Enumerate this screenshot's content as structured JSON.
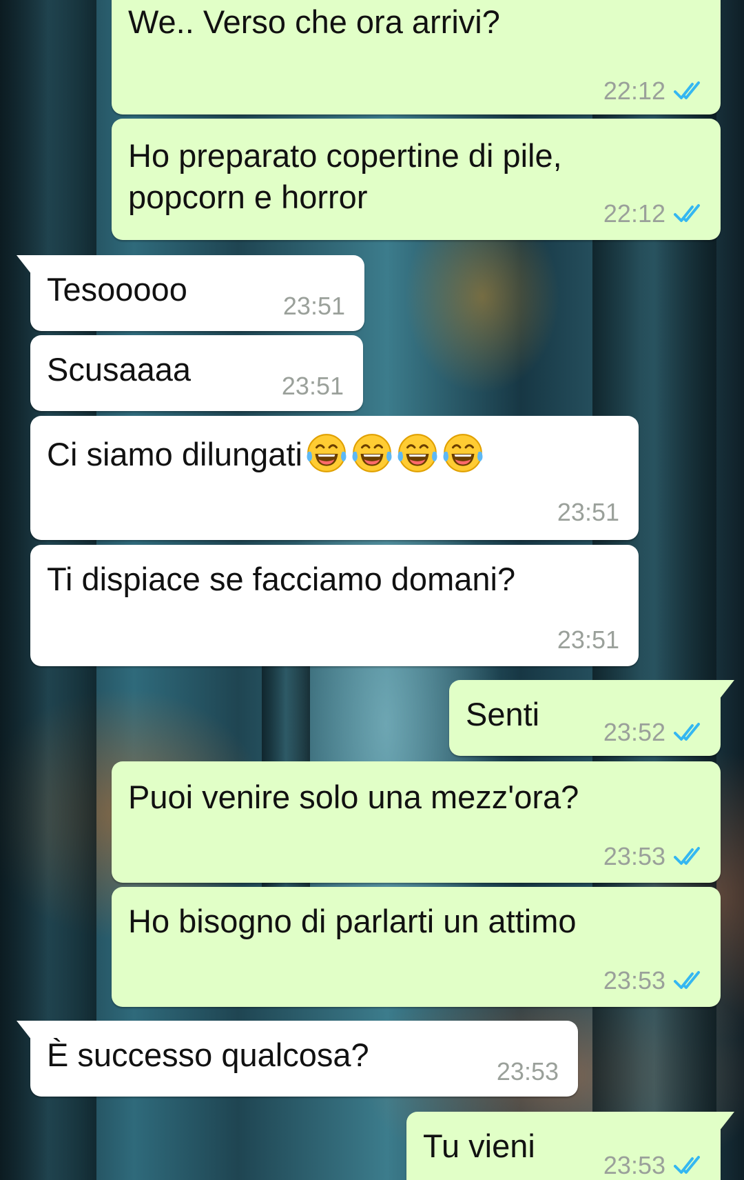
{
  "colors": {
    "outgoing_bubble": "#e1ffc7",
    "incoming_bubble": "#ffffff",
    "timestamp": "#9aa09a",
    "read_ticks": "#34b7f1"
  },
  "messages": [
    {
      "direction": "outgoing",
      "text": "We.. Verso che ora arrivi?",
      "time": "22:12",
      "status_icon": "double-check-read-icon"
    },
    {
      "direction": "outgoing",
      "text": "Ho preparato copertine di pile,",
      "text2": "popcorn e horror",
      "time": "22:12",
      "status_icon": "double-check-read-icon"
    },
    {
      "direction": "incoming",
      "text": "Tesooooo",
      "time": "23:51"
    },
    {
      "direction": "incoming",
      "text": "Scusaaaa",
      "time": "23:51"
    },
    {
      "direction": "incoming",
      "text": "Ci siamo dilungati",
      "emoji": "😂😂😂😂",
      "emoji_icon": "face-with-tears-of-joy-icon",
      "time": "23:51"
    },
    {
      "direction": "incoming",
      "text": "Ti dispiace se facciamo domani?",
      "time": "23:51"
    },
    {
      "direction": "outgoing",
      "text": "Senti",
      "time": "23:52",
      "status_icon": "double-check-read-icon"
    },
    {
      "direction": "outgoing",
      "text": "Puoi venire solo una mezz'ora?",
      "time": "23:53",
      "status_icon": "double-check-read-icon"
    },
    {
      "direction": "outgoing",
      "text": "Ho bisogno di parlarti un attimo",
      "time": "23:53",
      "status_icon": "double-check-read-icon"
    },
    {
      "direction": "incoming",
      "text": "È successo qualcosa?",
      "time": "23:53"
    },
    {
      "direction": "outgoing",
      "text": "Tu vieni",
      "time": "23:53",
      "status_icon": "double-check-read-icon"
    }
  ]
}
